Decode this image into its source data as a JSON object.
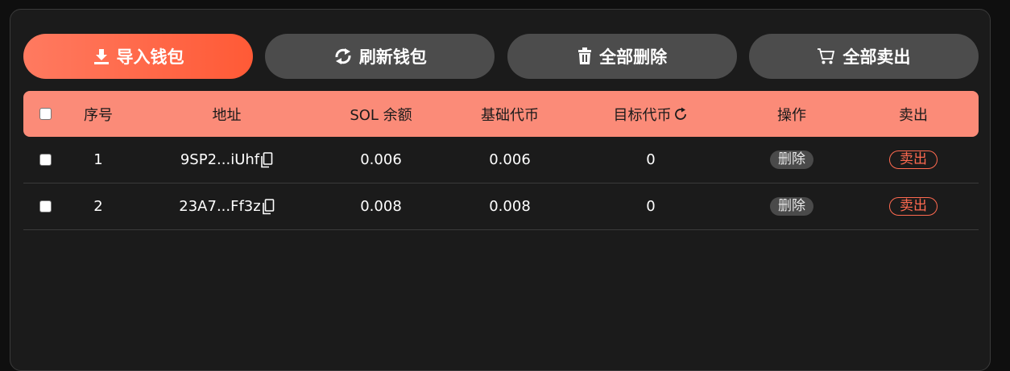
{
  "toolbar": {
    "import_label": "导入钱包",
    "refresh_label": "刷新钱包",
    "delete_all_label": "全部删除",
    "sell_all_label": "全部卖出"
  },
  "table": {
    "headers": {
      "index": "序号",
      "address": "地址",
      "sol_balance": "SOL 余额",
      "base_token": "基础代币",
      "target_token": "目标代币",
      "actions": "操作",
      "sell": "卖出"
    },
    "rows": [
      {
        "index": "1",
        "address": "9SP2...iUhf",
        "sol": "0.006",
        "base": "0.006",
        "target": "0",
        "delete_label": "删除",
        "sell_label": "卖出"
      },
      {
        "index": "2",
        "address": "23A7...Ff3z",
        "sol": "0.008",
        "base": "0.008",
        "target": "0",
        "delete_label": "删除",
        "sell_label": "卖出"
      }
    ]
  },
  "colors": {
    "accent": "#ff5a36",
    "header_bg": "#fb8b78",
    "panel_bg": "#1b1b1b",
    "button_bg": "#4c4c4c"
  },
  "icons": {
    "import": "download-icon",
    "refresh": "refresh-icon",
    "delete_all": "trash-icon",
    "sell_all": "cart-icon",
    "copy": "copy-icon",
    "target_refresh": "refresh-icon"
  }
}
